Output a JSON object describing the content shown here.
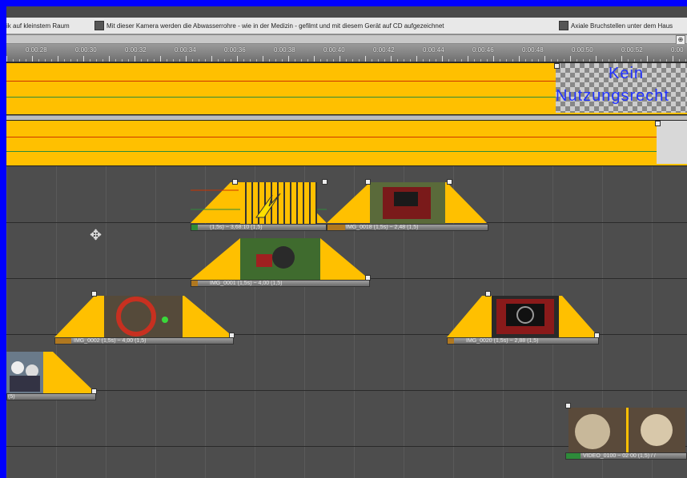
{
  "markers": [
    {
      "text": "ik auf kleinstem Raum"
    },
    {
      "text": "Mit dieser Kamera werden die Abwasserrohre - wie in der Medizin - gefilmt und mit diesem Gerät auf CD aufgezeichnet"
    },
    {
      "text": "Axiale Bruchstellen unter dem Haus"
    }
  ],
  "ruler": {
    "labels": [
      "0:00:28",
      "0:00:30",
      "0:00:32",
      "0:00:34",
      "0:00:36",
      "0:00:38",
      "0:00:40",
      "0:00:42",
      "0:00:44",
      "0:00:46",
      "0:00:48",
      "0:00:50",
      "0:00:52",
      "0:00"
    ]
  },
  "video_track_1": {
    "color": "#ffc000",
    "title_text": [
      "Kein",
      "Nutzungsrecht"
    ]
  },
  "video_track_2": {
    "color": "#ffc000"
  },
  "clips": [
    {
      "id": "clip-a",
      "label": "(1,5s) ~ 3,68:10 (1,5)",
      "thumb": "grid-arrow"
    },
    {
      "id": "clip-b",
      "label": "IMG_0018 (1,5s) ~ 2,48 (1,5)",
      "thumb": "device-red"
    },
    {
      "id": "clip-c",
      "label": "IMG_0001 (1,5s) ~ 4,00 (1,5)",
      "thumb": "garden"
    },
    {
      "id": "clip-d",
      "label": "IMG_0002 (1,5s) ~ 4,00 (1,5)",
      "thumb": "pipe-red"
    },
    {
      "id": "clip-e",
      "label": "IMG_0020 (1,5s) ~ 2,88 (1,5)",
      "thumb": "monitor"
    },
    {
      "id": "clip-f",
      "label": "(5)",
      "thumb": "workers"
    },
    {
      "id": "clip-g",
      "label": "VIDEO_0100 ~ 02 00 (1,5) / /",
      "thumb": "pipe-view"
    }
  ],
  "colors": {
    "accent": "#ffc000",
    "frame": "#0000ff",
    "timeline_bg": "#4d4d4d"
  }
}
